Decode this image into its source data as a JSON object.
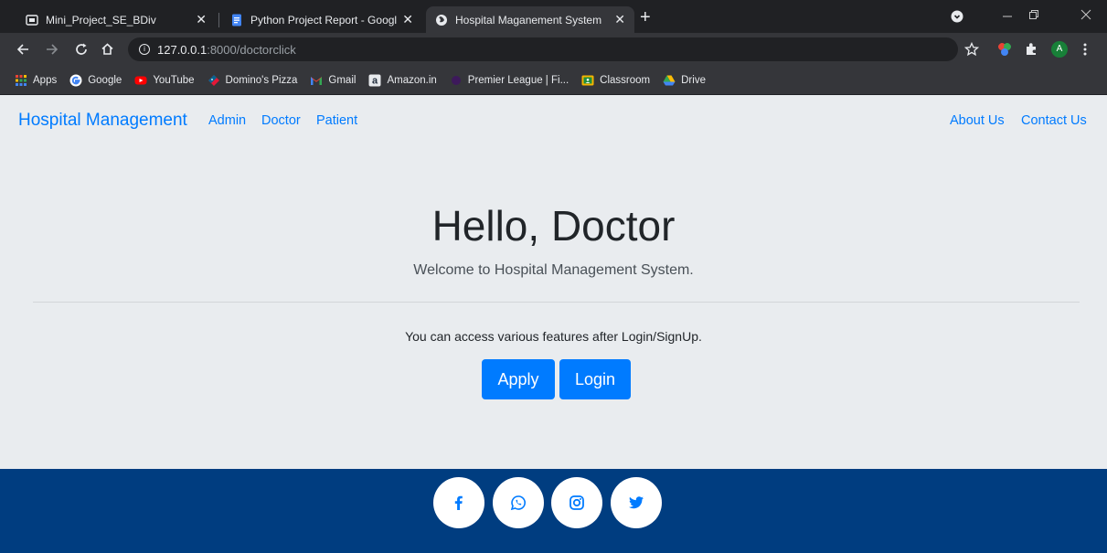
{
  "browser": {
    "tabs": [
      {
        "title": "Mini_Project_SE_BDiv",
        "close": "✕"
      },
      {
        "title": "Python Project Report - Google D",
        "close": "✕"
      },
      {
        "title": "Hospital Maganement System",
        "close": "✕"
      }
    ],
    "new_tab": "+",
    "url": {
      "host": "127.0.0.1",
      "path": ":8000/doctorclick"
    },
    "bookmarks": [
      "Apps",
      "Google",
      "YouTube",
      "Domino's Pizza",
      "Gmail",
      "Amazon.in",
      "Premier League | Fi...",
      "Classroom",
      "Drive"
    ],
    "profile_initial": "A"
  },
  "navbar": {
    "brand": "Hospital Management",
    "links": [
      "Admin",
      "Doctor",
      "Patient"
    ],
    "right_links": [
      "About Us",
      "Contact Us"
    ]
  },
  "hero": {
    "title": "Hello, Doctor",
    "subtitle": "Welcome to Hospital Management System.",
    "note": "You can access various features after Login/SignUp.",
    "buttons": [
      "Apply",
      "Login"
    ]
  },
  "footer": {
    "social_icons": [
      "facebook-icon",
      "whatsapp-icon",
      "instagram-icon",
      "twitter-icon"
    ]
  },
  "colors": {
    "primary": "#007bff",
    "page_bg": "#e9ecef",
    "footer_bg": "#003d80"
  }
}
